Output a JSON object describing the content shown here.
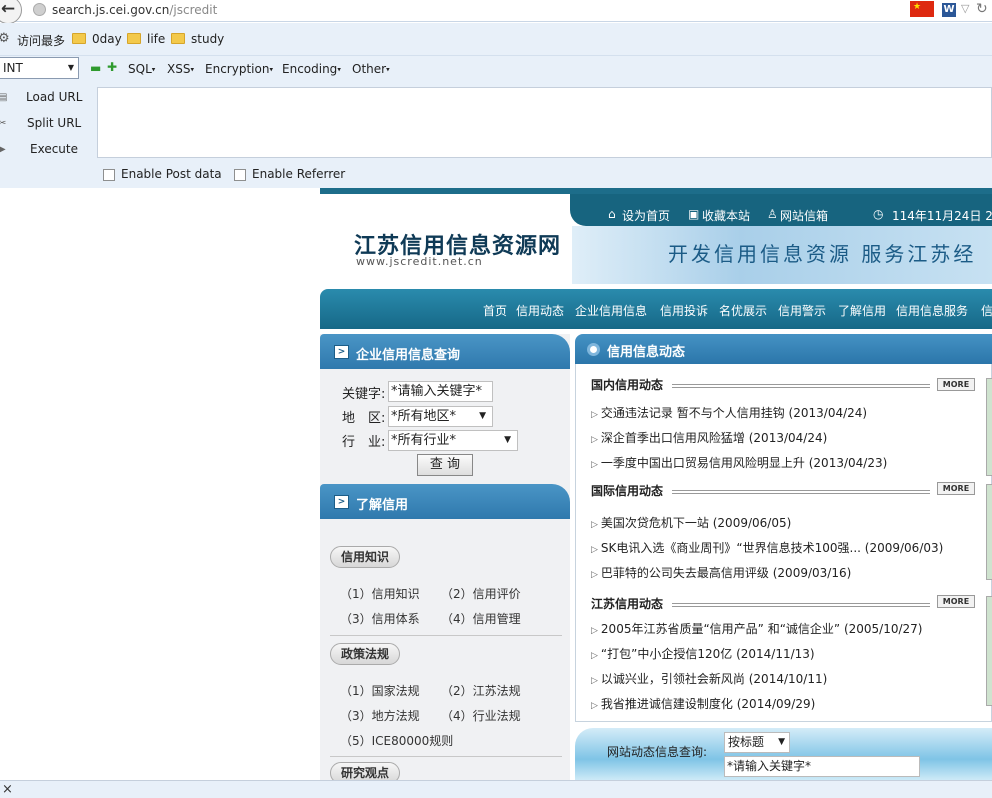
{
  "browser": {
    "url_host": "search.js.cei.gov.cn",
    "url_path": "/jscredit",
    "bookmarks": [
      "访问最多",
      "0day",
      "life",
      "study"
    ],
    "w_icon_text": "W"
  },
  "hackbar": {
    "select_value": "INT",
    "menus": [
      "SQL",
      "XSS",
      "Encryption",
      "Encoding",
      "Other"
    ],
    "load_url": "Load URL",
    "split_url": "Split URL",
    "execute": "Execute",
    "enable_post": "Enable Post data",
    "enable_referrer": "Enable Referrer",
    "url_value": ""
  },
  "site": {
    "top_links": [
      "设为首页",
      "收藏本站",
      "网站信箱"
    ],
    "date_text": "114年11月24日 2",
    "logo_cn": "江苏信用信息资源网",
    "logo_url": "www.jscredit.net.cn",
    "slogan": "开发信用信息资源  服务江苏经",
    "nav": [
      "首页",
      "信用动态",
      "企业信用信息",
      "信用投诉",
      "名优展示",
      "信用警示",
      "了解信用",
      "信用信息服务",
      "信"
    ],
    "query": {
      "title": "企业信用信息查询",
      "keyword_label": "关键字:",
      "keyword_value": "*请输入关键字*",
      "region_label": "地　区:",
      "region_value": "*所有地区*",
      "industry_label": "行　业:",
      "industry_value": "*所有行业*",
      "button": "查 询"
    },
    "learn": {
      "title": "了解信用",
      "sections": [
        {
          "label": "信用知识",
          "items": [
            "（1）信用知识",
            "（2）信用评价",
            "（3）信用体系",
            "（4）信用管理"
          ]
        },
        {
          "label": "政策法规",
          "items": [
            "（1）国家法规",
            "（2）江苏法规",
            "（3）地方法规",
            "（4）行业法规",
            "（5）ICE80000规则"
          ]
        },
        {
          "label": "研究观点",
          "items": []
        }
      ]
    },
    "news": {
      "title": "信用信息动态",
      "more": "MORE",
      "sections": [
        {
          "title": "国内信用动态",
          "items": [
            "交通违法记录 暂不与个人信用挂钩 (2013/04/24)",
            "深企首季出口信用风险猛增 (2013/04/24)",
            "一季度中国出口贸易信用风险明显上升 (2013/04/23)"
          ]
        },
        {
          "title": "国际信用动态",
          "items": [
            "美国次贷危机下一站 (2009/06/05)",
            "SK电讯入选《商业周刊》“世界信息技术100强... (2009/06/03)",
            "巴菲特的公司失去最高信用评级 (2009/03/16)"
          ]
        },
        {
          "title": "江苏信用动态",
          "items": [
            "2005年江苏省质量“信用产品” 和“诚信企业” (2005/10/27)",
            "“打包”中小企授信120亿 (2014/11/13)",
            "以诚兴业，引领社会新风尚 (2014/10/11)",
            "我省推进诚信建设制度化 (2014/09/29)"
          ]
        }
      ]
    },
    "site_search": {
      "label": "网站动态信息查询:",
      "select_value": "按标题",
      "input_value": "*请输入关键字*"
    }
  },
  "status": {
    "close": "×"
  }
}
